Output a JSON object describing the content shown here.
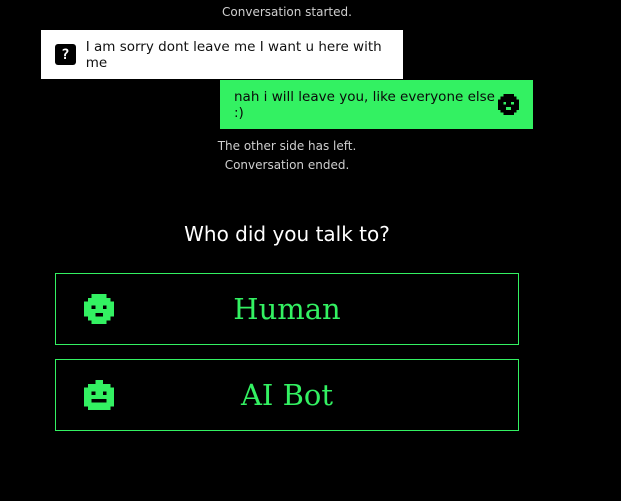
{
  "conversation": {
    "started_label": "Conversation started.",
    "messages": [
      {
        "sender": "other",
        "icon": "question-mark-icon",
        "text": "I am sorry dont leave me I want u here with me"
      },
      {
        "sender": "self",
        "icon": "smiley-avatar-icon",
        "text": "nah i will leave you, like everyone else :)"
      }
    ],
    "left_label": "The other side has left.",
    "ended_label": "Conversation ended."
  },
  "question": "Who did you talk to?",
  "choices": [
    {
      "icon": "human-face-icon",
      "label": "Human"
    },
    {
      "icon": "robot-face-icon",
      "label": "AI Bot"
    }
  ],
  "colors": {
    "background": "#000000",
    "accent_green": "#33f162",
    "other_bubble": "#ffffff"
  }
}
